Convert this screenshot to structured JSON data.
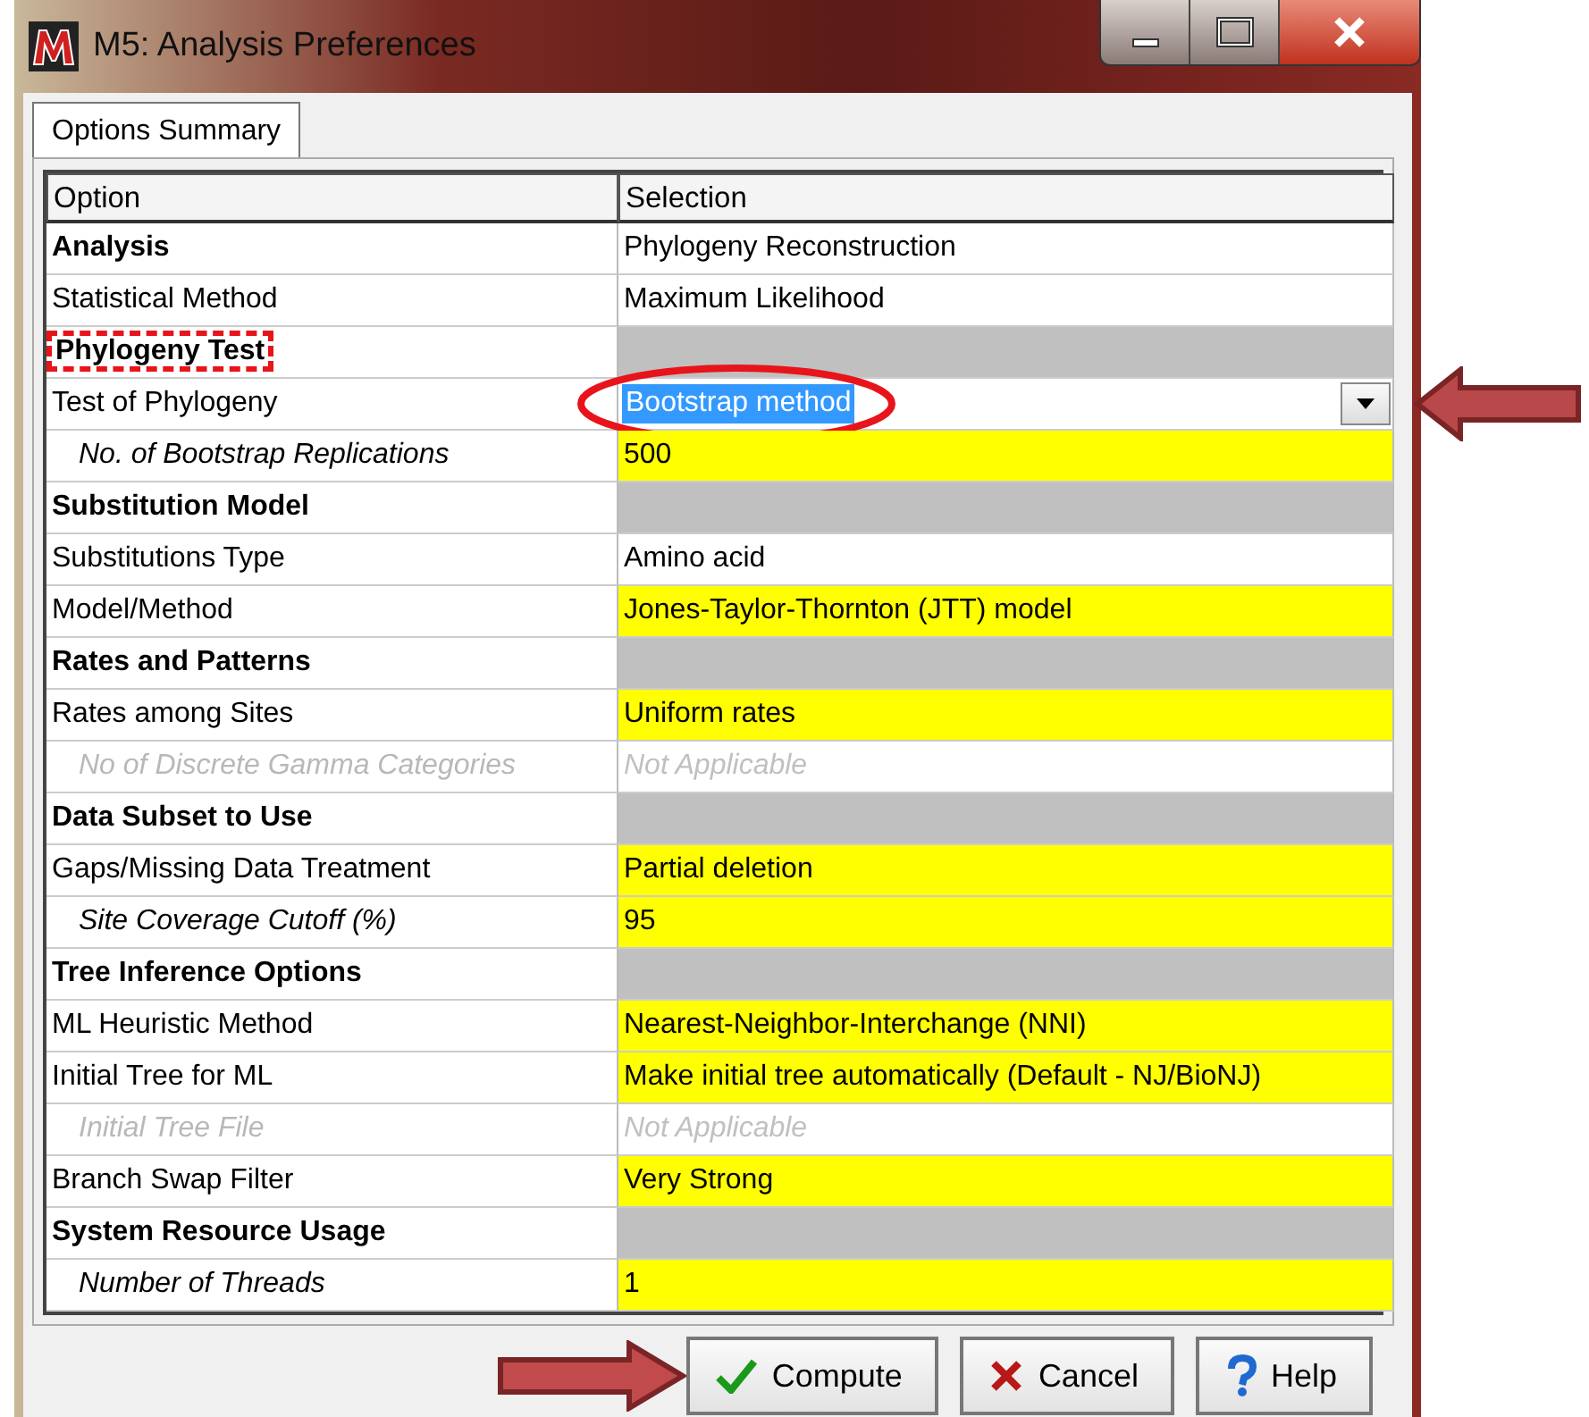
{
  "window": {
    "title": "M5: Analysis Preferences"
  },
  "tabs": [
    {
      "label": "Options Summary",
      "selected": true
    }
  ],
  "table": {
    "columns": [
      "Option",
      "Selection"
    ],
    "rows": [
      {
        "kind": "section",
        "label": "Analysis",
        "value": "Phylogeny Reconstruction",
        "editable": false
      },
      {
        "kind": "option",
        "label": "Statistical Method",
        "value": "Maximum Likelihood",
        "editable": false
      },
      {
        "kind": "section",
        "label": "Phylogeny Test",
        "marked": true
      },
      {
        "kind": "option",
        "label": "Test of Phylogeny",
        "value": "Bootstrap method",
        "dropdown": true,
        "selected": true,
        "circled": true,
        "arrow": true
      },
      {
        "kind": "sub",
        "label": "No. of Bootstrap Replications",
        "value": "500",
        "editable": true
      },
      {
        "kind": "section",
        "label": "Substitution Model"
      },
      {
        "kind": "option",
        "label": "Substitutions Type",
        "value": "Amino acid",
        "editable": false
      },
      {
        "kind": "option",
        "label": "Model/Method",
        "value": "Jones-Taylor-Thornton (JTT) model",
        "editable": true
      },
      {
        "kind": "section",
        "label": "Rates and Patterns"
      },
      {
        "kind": "option",
        "label": "Rates among Sites",
        "value": "Uniform rates",
        "editable": true
      },
      {
        "kind": "sub",
        "label": "No of Discrete Gamma Categories",
        "value": "Not Applicable",
        "editable": false,
        "disabled": true
      },
      {
        "kind": "section",
        "label": "Data Subset to Use"
      },
      {
        "kind": "option",
        "label": "Gaps/Missing Data Treatment",
        "value": "Partial deletion",
        "editable": true
      },
      {
        "kind": "sub",
        "label": "Site Coverage Cutoff (%)",
        "value": "95",
        "editable": true
      },
      {
        "kind": "section",
        "label": "Tree Inference Options"
      },
      {
        "kind": "option",
        "label": "ML Heuristic Method",
        "value": "Nearest-Neighbor-Interchange (NNI)",
        "editable": true
      },
      {
        "kind": "option",
        "label": "Initial Tree for ML",
        "value": "Make initial tree automatically (Default - NJ/BioNJ)",
        "editable": true
      },
      {
        "kind": "sub",
        "label": "Initial Tree File",
        "value": "Not Applicable",
        "editable": false,
        "disabled": true
      },
      {
        "kind": "option",
        "label": "Branch Swap Filter",
        "value": "Very Strong",
        "editable": true
      },
      {
        "kind": "section",
        "label": "System Resource Usage"
      },
      {
        "kind": "sub",
        "label": "Number of Threads",
        "value": "1",
        "editable": true
      }
    ]
  },
  "buttons": [
    {
      "kind": "compute",
      "label": "Compute",
      "arrow": true
    },
    {
      "kind": "cancel",
      "label": "Cancel"
    },
    {
      "kind": "help",
      "label": "Help"
    }
  ]
}
